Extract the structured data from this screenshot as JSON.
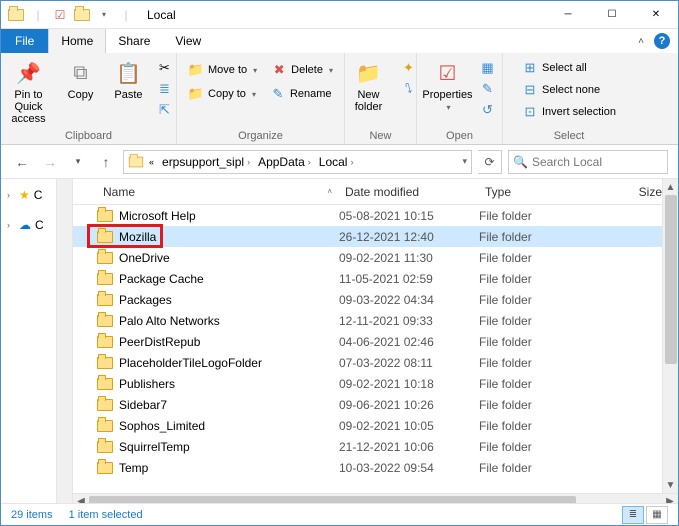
{
  "window": {
    "title": "Local"
  },
  "tabs": {
    "file": "File",
    "home": "Home",
    "share": "Share",
    "view": "View"
  },
  "ribbon": {
    "clipboard": {
      "label": "Clipboard",
      "pin": "Pin to Quick access",
      "copy": "Copy",
      "paste": "Paste"
    },
    "organize": {
      "label": "Organize",
      "moveto": "Move to",
      "copyto": "Copy to",
      "delete": "Delete",
      "rename": "Rename"
    },
    "new": {
      "label": "New",
      "newfolder": "New folder"
    },
    "open": {
      "label": "Open",
      "properties": "Properties"
    },
    "select": {
      "label": "Select",
      "all": "Select all",
      "none": "Select none",
      "invert": "Invert selection"
    }
  },
  "breadcrumb": [
    "erpsupport_sipl",
    "AppData",
    "Local"
  ],
  "search": {
    "placeholder": "Search Local"
  },
  "columns": {
    "name": "Name",
    "date": "Date modified",
    "type": "Type",
    "size": "Size"
  },
  "items": [
    {
      "name": "Microsoft Help",
      "date": "05-08-2021 10:15",
      "type": "File folder"
    },
    {
      "name": "Mozilla",
      "date": "26-12-2021 12:40",
      "type": "File folder",
      "selected": true,
      "highlight": true
    },
    {
      "name": "OneDrive",
      "date": "09-02-2021 11:30",
      "type": "File folder"
    },
    {
      "name": "Package Cache",
      "date": "11-05-2021 02:59",
      "type": "File folder"
    },
    {
      "name": "Packages",
      "date": "09-03-2022 04:34",
      "type": "File folder"
    },
    {
      "name": "Palo Alto Networks",
      "date": "12-11-2021 09:33",
      "type": "File folder"
    },
    {
      "name": "PeerDistRepub",
      "date": "04-06-2021 02:46",
      "type": "File folder"
    },
    {
      "name": "PlaceholderTileLogoFolder",
      "date": "07-03-2022 08:11",
      "type": "File folder"
    },
    {
      "name": "Publishers",
      "date": "09-02-2021 10:18",
      "type": "File folder"
    },
    {
      "name": "Sidebar7",
      "date": "09-06-2021 10:26",
      "type": "File folder"
    },
    {
      "name": "Sophos_Limited",
      "date": "09-02-2021 10:05",
      "type": "File folder"
    },
    {
      "name": "SquirrelTemp",
      "date": "21-12-2021 10:06",
      "type": "File folder"
    },
    {
      "name": "Temp",
      "date": "10-03-2022 09:54",
      "type": "File folder"
    }
  ],
  "status": {
    "items": "29 items",
    "selected": "1 item selected"
  }
}
